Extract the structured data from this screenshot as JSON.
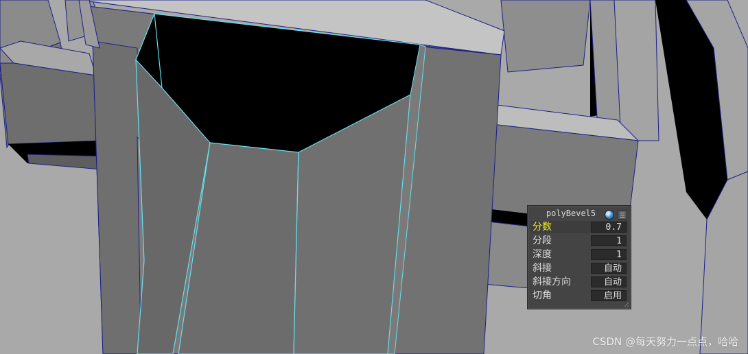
{
  "viewport": {
    "background_color": "#a9a9a9",
    "wire_color": "#1c1f88",
    "selection_color": "#66e0ee",
    "hole_color": "#000000"
  },
  "hud": {
    "title": "polyBevel5",
    "icons": [
      "globe-icon",
      "menu-icon"
    ],
    "rows": [
      {
        "label": "分数",
        "value": "0.7",
        "highlighted": true
      },
      {
        "label": "分段",
        "value": "1",
        "highlighted": false
      },
      {
        "label": "深度",
        "value": "1",
        "highlighted": false
      },
      {
        "label": "斜接",
        "value": "自动",
        "highlighted": false
      },
      {
        "label": "斜接方向",
        "value": "自动",
        "highlighted": false
      },
      {
        "label": "切角",
        "value": "启用",
        "highlighted": false
      }
    ],
    "label_highlight_color": "#f2ee2c"
  },
  "watermark": {
    "text": "CSDN @每天努力一点点，哈哈"
  }
}
